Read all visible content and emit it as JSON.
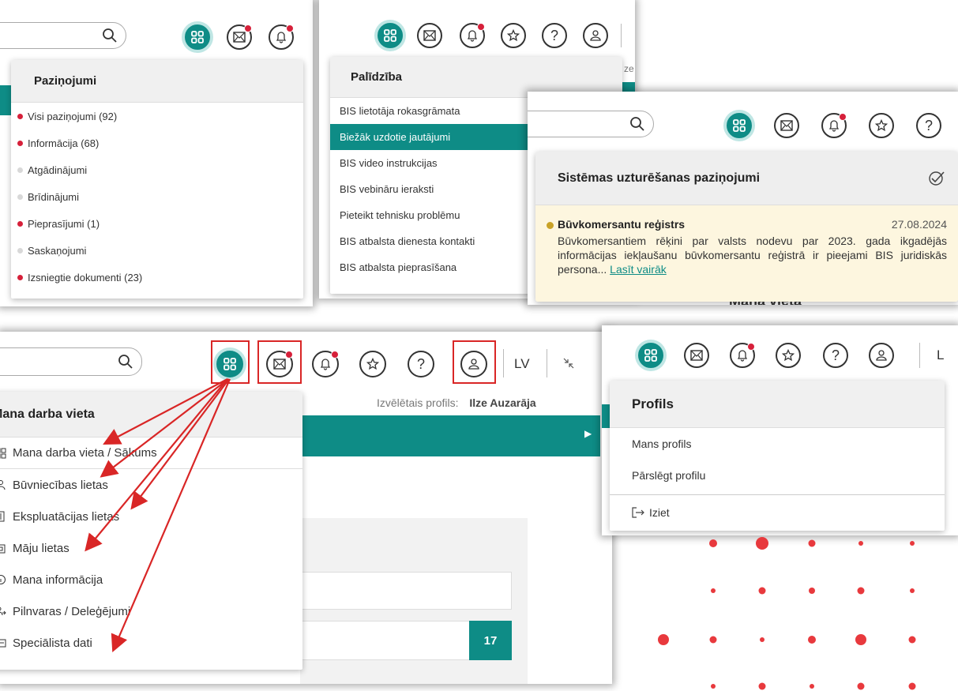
{
  "colors": {
    "teal": "#0e8c86",
    "badge": "#d6203a",
    "callout": "#d92626",
    "gray_bullet": "#d8d8d8",
    "maint_dot": "#c9a227"
  },
  "panel_notifications": {
    "title": "Paziņojumi",
    "items": [
      {
        "label": "Visi paziņojumi (92)",
        "bullet": "red"
      },
      {
        "label": "Informācija (68)",
        "bullet": "red"
      },
      {
        "label": "Atgādinājumi",
        "bullet": "gray"
      },
      {
        "label": "Brīdinājumi",
        "bullet": "gray"
      },
      {
        "label": "Pieprasījumi (1)",
        "bullet": "red"
      },
      {
        "label": "Saskaņojumi",
        "bullet": "gray"
      },
      {
        "label": "Izsniegtie dokumenti (23)",
        "bullet": "red"
      }
    ]
  },
  "panel_help": {
    "title": "Palīdzība",
    "clipped_text": "ze",
    "items": [
      "BIS lietotāja rokasgrāmata",
      "Biežāk uzdotie jautājumi",
      "BIS video instrukcijas",
      "BIS vebināru ieraksti",
      "Pieteikt tehnisku problēmu",
      "BIS atbalsta dienesta kontakti",
      "BIS atbalsta pieprasīšana"
    ],
    "active_index": 1
  },
  "panel_maintenance": {
    "title": "Sistēmas uzturēšanas paziņojumi",
    "item_title": "Būvkomersantu reģistrs",
    "item_date": "27.08.2024",
    "item_body": "Būvkomersantiem rēķini par valsts nodevu par 2023. gada ikgadējās informācijas iekļaušanu būvkomersantu reģistrā ir pieejami BIS juridiskās persona...",
    "read_more": "Lasīt vairāk",
    "below_text": "Mana vieta"
  },
  "panel_workplace": {
    "lang": "LV",
    "profile_label": "Izvēlētais profils:",
    "profile_name": "Ilze Auzarāja",
    "menu_title": "Mana darba vieta",
    "items": [
      {
        "label": "Mana darba vieta / Sākums",
        "icon": "grid-icon"
      },
      {
        "label": "Būvniecības lietas",
        "icon": "person-icon"
      },
      {
        "label": "Ekspluatācijas lietas",
        "icon": "building-icon"
      },
      {
        "label": "Māju lietas",
        "icon": "house-icon"
      },
      {
        "label": "Mana informācija",
        "icon": "info-icon"
      },
      {
        "label": "Pilnvaras / Deleģējumi",
        "icon": "users-icon"
      },
      {
        "label": "Speciālista dati",
        "icon": "id-card-icon"
      }
    ],
    "count_badge": "17"
  },
  "panel_profile": {
    "title": "Profils",
    "clipped_lang": "L",
    "items": [
      "Mans profils",
      "Pārslēgt profilu"
    ],
    "logout": "Iziet"
  }
}
